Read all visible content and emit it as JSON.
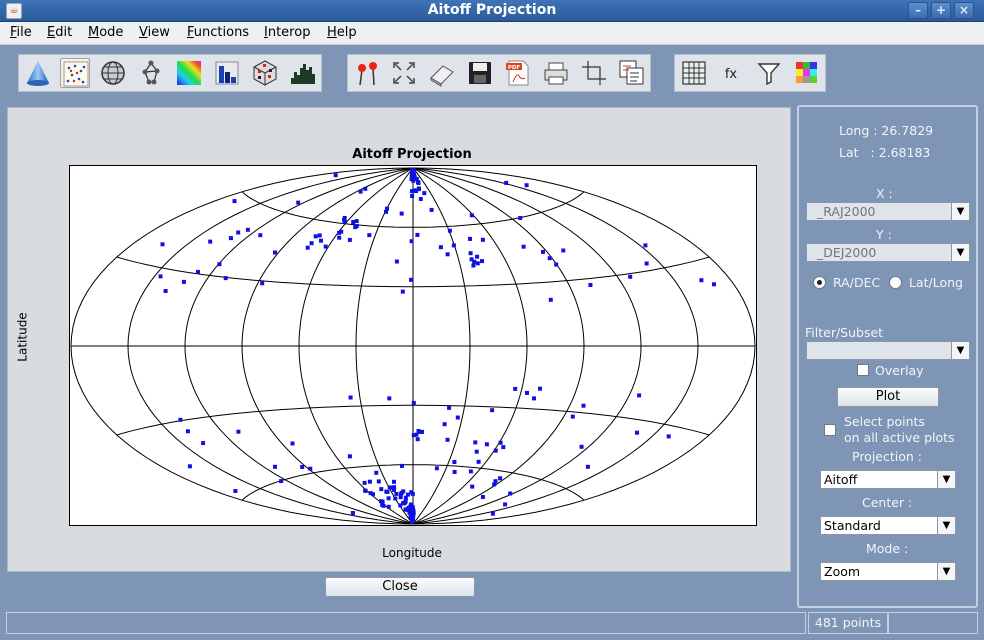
{
  "window": {
    "title": "Aitoff Projection"
  },
  "menu": {
    "items": [
      {
        "mnemonic": "F",
        "rest": "ile"
      },
      {
        "mnemonic": "E",
        "rest": "dit"
      },
      {
        "mnemonic": "M",
        "rest": "ode"
      },
      {
        "mnemonic": "V",
        "rest": "iew"
      },
      {
        "mnemonic": "F",
        "rest": "unctions"
      },
      {
        "mnemonic": "I",
        "rest": "nterop"
      },
      {
        "mnemonic": "H",
        "rest": "elp"
      }
    ]
  },
  "toolbar": {
    "groups": [
      [
        "cone-icon",
        "scatter-plot-icon",
        "globe-icon",
        "network-icon",
        "color-map-icon",
        "bar-chart-icon",
        "cube-icon",
        "histogram-icon"
      ],
      [
        "pushpin-icon",
        "fit-zoom-icon",
        "eraser-icon",
        "save-icon",
        "pdf-icon",
        "print-icon",
        "crop-icon",
        "copy-icon"
      ],
      [
        "table-icon",
        "fx-icon",
        "filter-icon",
        "palette-icon"
      ]
    ],
    "fx_label": "fx",
    "pdf_label": "PDF"
  },
  "plot": {
    "title": "Aitoff Projection",
    "xlabel": "Longitude",
    "ylabel": "Latitude",
    "point_color": "#1010e0"
  },
  "side": {
    "long_label": "Long :",
    "long_value": "26.7829",
    "lat_label": "Lat   :",
    "lat_value": "2.68183",
    "x_label": "X :",
    "x_value": "_RAJ2000",
    "y_label": "Y :",
    "y_value": "_DEJ2000",
    "radio_radec": "RA/DEC",
    "radio_latlong": "Lat/Long",
    "radio_selected": "radec",
    "filter_label": "Filter/Subset",
    "filter_value": "",
    "overlay_label": "Overlay",
    "plot_button": "Plot",
    "select_points_line1": "Select points",
    "select_points_line2": "on all active plots",
    "projection_label": "Projection :",
    "projection_value": "Aitoff",
    "center_label": "Center :",
    "center_value": "Standard",
    "mode_label": "Mode :",
    "mode_value": "Zoom"
  },
  "close_button": "Close",
  "status": {
    "points": "481 points"
  },
  "colors": {
    "panel_bg": "#7e95b6",
    "title_bg": "#2f63a8"
  }
}
